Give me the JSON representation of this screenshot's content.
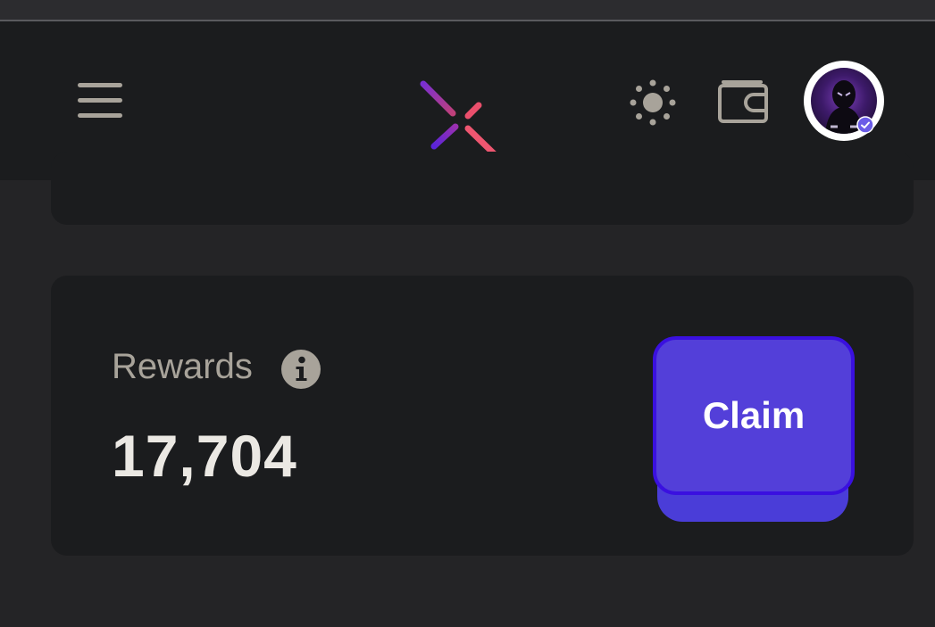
{
  "header": {
    "menu_icon": "hamburger-menu-icon",
    "logo_icon": "x-logo-icon",
    "theme_icon": "sun-icon",
    "wallet_icon": "wallet-icon",
    "avatar_badge_icon": "verified-check-icon"
  },
  "rewards": {
    "label": "Rewards",
    "info_icon": "info-icon",
    "value": "17,704",
    "claim_label": "Claim"
  },
  "colors": {
    "page_background": "#242426",
    "card_background": "#1b1c1e",
    "muted_text": "#a8a39a",
    "primary_text": "#ebe8e3",
    "accent": "#533fd9",
    "accent_border": "#3a10e0",
    "logo_gradient_start": "#8a2be2",
    "logo_gradient_end": "#f05a78"
  }
}
